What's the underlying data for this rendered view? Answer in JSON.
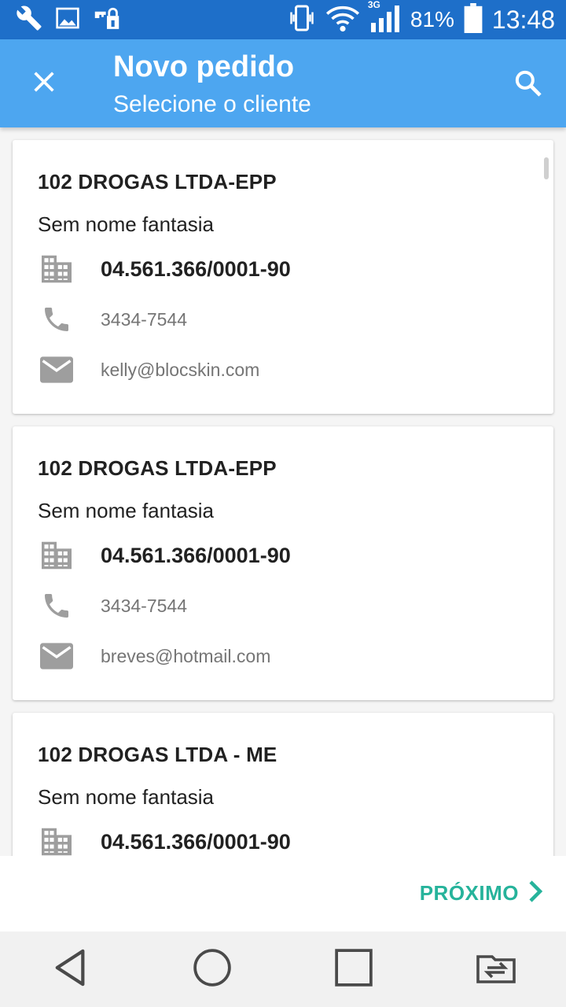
{
  "status_bar": {
    "battery": "81%",
    "time": "13:48",
    "network": "3G",
    "icons": [
      "wrench-icon",
      "image-icon",
      "vpn-key-icon",
      "vibrate-icon",
      "wifi-icon",
      "signal-icon",
      "battery-icon"
    ]
  },
  "app_bar": {
    "title": "Novo pedido",
    "subtitle": "Selecione o cliente",
    "close_icon": "close-icon",
    "search_icon": "search-icon",
    "color": "#4da6f0"
  },
  "clients": [
    {
      "name": "102 DROGAS LTDA-EPP",
      "fantasy": "Sem nome fantasia",
      "cnpj": "04.561.366/0001-90",
      "phone": "3434-7544",
      "email": "kelly@blocskin.com"
    },
    {
      "name": "102 DROGAS LTDA-EPP",
      "fantasy": "Sem nome fantasia",
      "cnpj": "04.561.366/0001-90",
      "phone": "3434-7544",
      "email": "breves@hotmail.com"
    },
    {
      "name": "102 DROGAS LTDA - ME",
      "fantasy": "Sem nome fantasia",
      "cnpj": "04.561.366/0001-90",
      "phone": "",
      "email": ""
    }
  ],
  "footer": {
    "next_label": "PRÓXIMO",
    "accent": "#26b39b"
  },
  "nav_bar": {
    "icons": [
      "back-icon",
      "home-icon",
      "recents-icon",
      "switch-app-icon"
    ]
  }
}
